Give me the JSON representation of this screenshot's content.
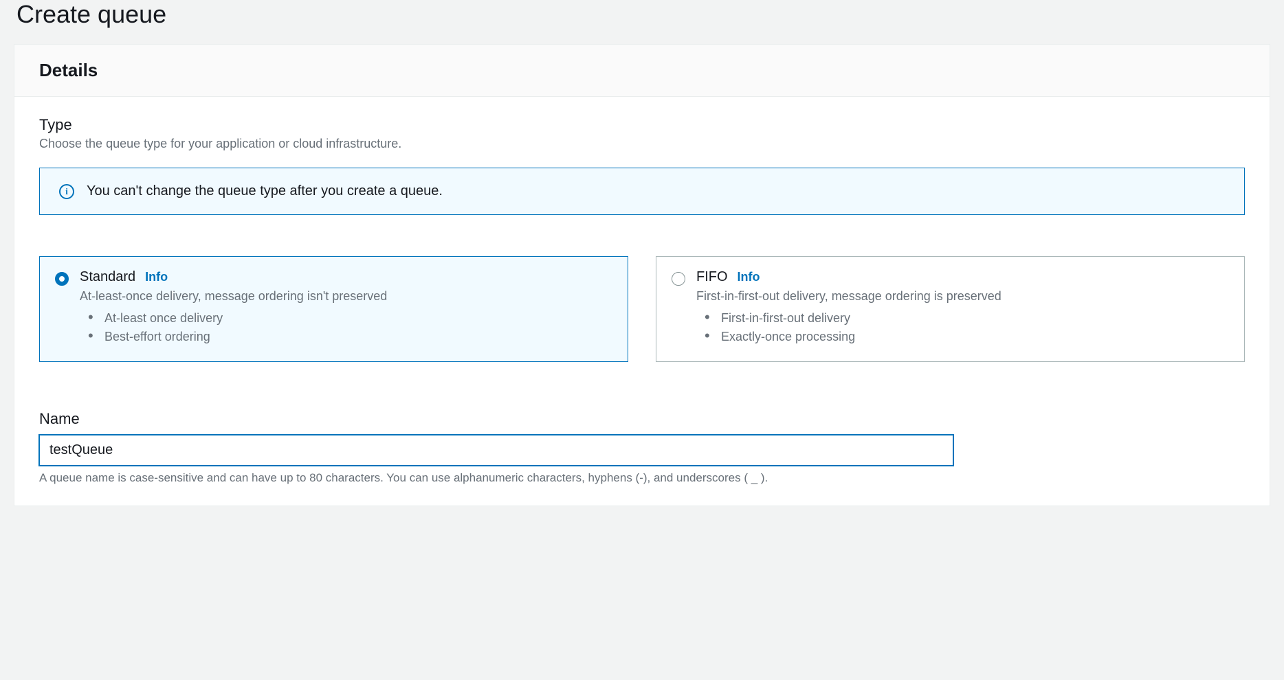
{
  "page": {
    "title": "Create queue"
  },
  "details": {
    "header": "Details",
    "type": {
      "label": "Type",
      "description": "Choose the queue type for your application or cloud infrastructure.",
      "banner": {
        "icon_glyph": "i",
        "text": "You can't change the queue type after you create a queue."
      },
      "options": [
        {
          "title": "Standard",
          "info_label": "Info",
          "description": "At-least-once delivery, message ordering isn't preserved",
          "bullets": [
            "At-least once delivery",
            "Best-effort ordering"
          ],
          "selected": true
        },
        {
          "title": "FIFO",
          "info_label": "Info",
          "description": "First-in-first-out delivery, message ordering is preserved",
          "bullets": [
            "First-in-first-out delivery",
            "Exactly-once processing"
          ],
          "selected": false
        }
      ]
    },
    "name": {
      "label": "Name",
      "value": "testQueue",
      "help": "A queue name is case-sensitive and can have up to 80 characters. You can use alphanumeric characters, hyphens (-), and underscores ( _ )."
    }
  }
}
